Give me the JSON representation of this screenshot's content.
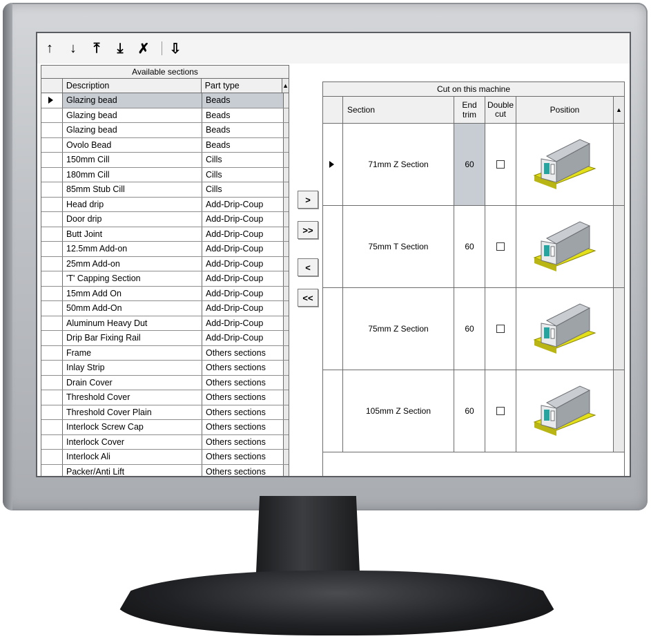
{
  "toolbar": {
    "buttons": [
      {
        "name": "move-up-icon",
        "glyph": "↑"
      },
      {
        "name": "move-down-icon",
        "glyph": "↓"
      },
      {
        "name": "move-top-icon",
        "glyph": "⤒"
      },
      {
        "name": "move-bottom-icon",
        "glyph": "⤓"
      },
      {
        "name": "delete-icon",
        "glyph": "✗"
      },
      {
        "name": "sort-icon",
        "glyph": "⇩"
      }
    ]
  },
  "left_grid": {
    "title": "Available sections",
    "columns": [
      "Description",
      "Part type"
    ],
    "rows": [
      {
        "description": "Glazing bead",
        "part_type": "Beads",
        "selected": true
      },
      {
        "description": "Glazing bead",
        "part_type": "Beads"
      },
      {
        "description": "Glazing bead",
        "part_type": "Beads"
      },
      {
        "description": "Ovolo Bead",
        "part_type": "Beads"
      },
      {
        "description": "150mm Cill",
        "part_type": "Cills"
      },
      {
        "description": "180mm Cill",
        "part_type": "Cills"
      },
      {
        "description": "85mm Stub Cill",
        "part_type": "Cills"
      },
      {
        "description": "Head drip",
        "part_type": "Add-Drip-Coup"
      },
      {
        "description": "Door drip",
        "part_type": "Add-Drip-Coup"
      },
      {
        "description": "Butt Joint",
        "part_type": "Add-Drip-Coup"
      },
      {
        "description": "12.5mm Add-on",
        "part_type": "Add-Drip-Coup"
      },
      {
        "description": "25mm Add-on",
        "part_type": "Add-Drip-Coup"
      },
      {
        "description": "'T' Capping Section",
        "part_type": "Add-Drip-Coup"
      },
      {
        "description": "15mm Add On",
        "part_type": "Add-Drip-Coup"
      },
      {
        "description": "50mm Add-On",
        "part_type": "Add-Drip-Coup"
      },
      {
        "description": "Aluminum Heavy Dut",
        "part_type": "Add-Drip-Coup"
      },
      {
        "description": "Drip Bar Fixing Rail",
        "part_type": "Add-Drip-Coup"
      },
      {
        "description": "Frame",
        "part_type": "Others sections"
      },
      {
        "description": "Inlay Strip",
        "part_type": "Others sections"
      },
      {
        "description": "Drain Cover",
        "part_type": "Others sections"
      },
      {
        "description": "Threshold Cover",
        "part_type": "Others sections"
      },
      {
        "description": "Threshold Cover Plain",
        "part_type": "Others sections"
      },
      {
        "description": "Interlock Screw Cap",
        "part_type": "Others sections"
      },
      {
        "description": "Interlock Cover",
        "part_type": "Others sections"
      },
      {
        "description": "Interlock Ali",
        "part_type": "Others sections"
      },
      {
        "description": "Packer/Anti Lift",
        "part_type": "Others sections"
      }
    ]
  },
  "transfer": {
    "add": ">",
    "add_all": ">>",
    "remove": "<",
    "remove_all": "<<"
  },
  "right_grid": {
    "title": "Cut on this machine",
    "columns": {
      "section": "Section",
      "end_trim": "End trim",
      "double_cut": "Double cut",
      "position": "Position"
    },
    "rows": [
      {
        "section": "71mm Z Section",
        "end_trim": "60",
        "double_cut": false,
        "selected": true
      },
      {
        "section": "75mm T Section",
        "end_trim": "60",
        "double_cut": false
      },
      {
        "section": "75mm Z Section",
        "end_trim": "60",
        "double_cut": false
      },
      {
        "section": "105mm Z Section",
        "end_trim": "60",
        "double_cut": false
      }
    ]
  },
  "colors": {
    "selection": "#c8cdd4",
    "profile_metal": "#9ea3a8",
    "profile_base": "#e3e01a",
    "profile_seal": "#27a3a0"
  }
}
